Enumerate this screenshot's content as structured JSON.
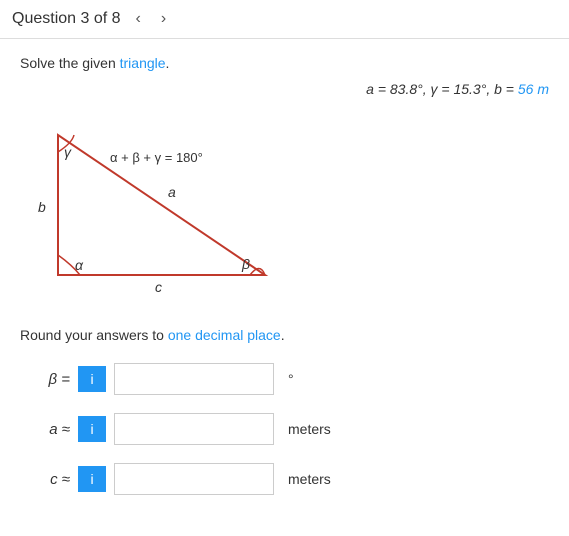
{
  "header": {
    "title": "Question 3 of 8",
    "prev_label": "‹",
    "next_label": "›"
  },
  "instruction": {
    "text_before": "Solve the given ",
    "highlight": "triangle",
    "text_after": "."
  },
  "answer_display": {
    "text": "a = 83.8°, γ = 15.3°, b = 56 m",
    "alpha_label": "a",
    "alpha_val": "83.8°",
    "gamma_label": "γ",
    "gamma_val": "15.3°",
    "b_label": "b",
    "b_val": "56 m"
  },
  "diagram": {
    "equation": "α + β + γ = 180°"
  },
  "round_note": {
    "prefix": "Round your answers to ",
    "highlight": "one decimal place",
    "suffix": "."
  },
  "inputs": [
    {
      "label": "β =",
      "btn_label": "i",
      "unit": "°",
      "placeholder": ""
    },
    {
      "label": "a ≈",
      "btn_label": "i",
      "unit": "meters",
      "placeholder": ""
    },
    {
      "label": "c ≈",
      "btn_label": "i",
      "unit": "meters",
      "placeholder": ""
    }
  ]
}
